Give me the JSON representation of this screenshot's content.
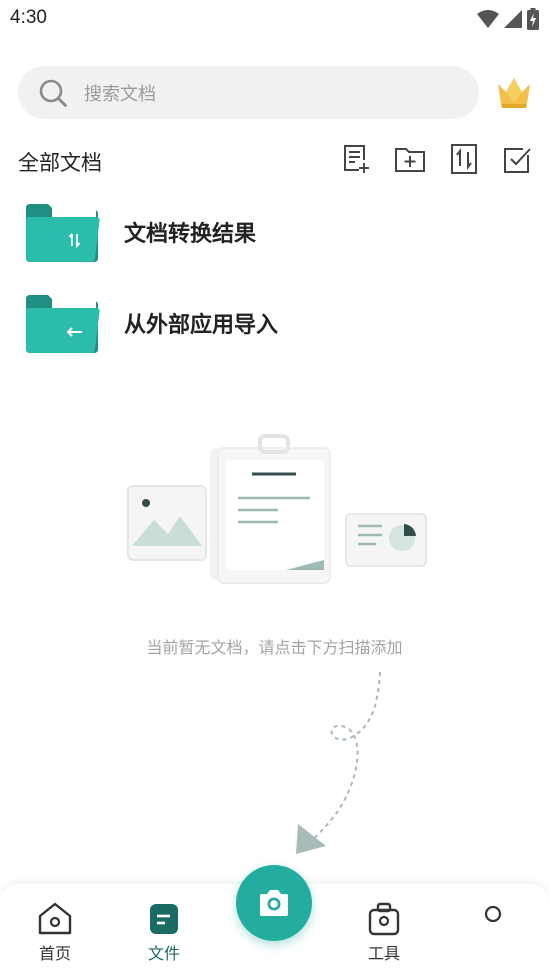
{
  "status_bar": {
    "time": "4:30",
    "icons": [
      "wifi-icon",
      "signal-icon",
      "battery-charging-icon"
    ]
  },
  "search": {
    "placeholder": "搜索文档",
    "icon": "search-icon"
  },
  "vip": {
    "icon": "crown-icon",
    "color": "#f2c04a"
  },
  "section": {
    "title": "全部文档",
    "actions": [
      {
        "name": "new-document-icon"
      },
      {
        "name": "new-folder-icon"
      },
      {
        "name": "sort-icon"
      },
      {
        "name": "select-checkbox-icon"
      }
    ]
  },
  "folders": [
    {
      "label": "文档转换结果",
      "icon": "folder-convert-icon"
    },
    {
      "label": "从外部应用导入",
      "icon": "folder-import-icon"
    }
  ],
  "empty_state": {
    "message": "当前暂无文档，请点击下方扫描添加"
  },
  "bottom_nav": {
    "items": [
      {
        "label": "首页",
        "icon": "home-icon",
        "active": false
      },
      {
        "label": "文件",
        "icon": "file-icon",
        "active": true
      },
      {
        "label": "工具",
        "icon": "toolbox-icon",
        "active": false
      },
      {
        "label": "",
        "icon": "profile-icon",
        "active": false
      }
    ],
    "scan_button": {
      "icon": "camera-icon"
    }
  },
  "colors": {
    "accent": "#23ad9e",
    "accent_dark": "#1a6b64",
    "search_bg": "#f1f1f1"
  }
}
